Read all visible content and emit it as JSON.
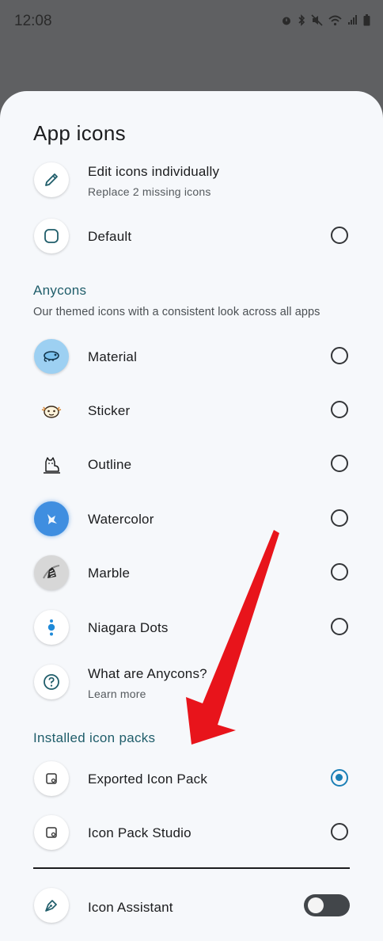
{
  "status_bar": {
    "time": "12:08",
    "icons": [
      "alarm-icon",
      "bluetooth-icon",
      "mute-icon",
      "wifi-icon",
      "signal-icon",
      "battery-icon"
    ]
  },
  "sheet": {
    "title": "App icons",
    "edit": {
      "label": "Edit icons individually",
      "sub": "Replace 2 missing icons",
      "icon": "pencil-icon"
    },
    "default": {
      "label": "Default",
      "icon": "rounded-square-icon",
      "selected": false
    },
    "anycons": {
      "header": "Anycons",
      "description": "Our themed icons with a consistent look across all apps",
      "items": [
        {
          "label": "Material",
          "icon": "chameleon-material-icon",
          "selected": false
        },
        {
          "label": "Sticker",
          "icon": "axolotl-sticker-icon",
          "selected": false
        },
        {
          "label": "Outline",
          "icon": "cat-outline-icon",
          "selected": false
        },
        {
          "label": "Watercolor",
          "icon": "watercolor-icon",
          "selected": false
        },
        {
          "label": "Marble",
          "icon": "marble-icon",
          "selected": false
        },
        {
          "label": "Niagara Dots",
          "icon": "dots-icon",
          "selected": false
        }
      ],
      "help": {
        "label": "What are Anycons?",
        "sub": "Learn more",
        "icon": "question-icon"
      }
    },
    "installed": {
      "header": "Installed icon packs",
      "items": [
        {
          "label": "Exported Icon Pack",
          "icon": "icon-pack-icon",
          "selected": true
        },
        {
          "label": "Icon Pack Studio",
          "icon": "icon-pack-icon",
          "selected": false
        }
      ]
    },
    "assistant": {
      "label": "Icon Assistant",
      "icon": "pen-nib-icon",
      "enabled": false
    }
  },
  "colors": {
    "accent": "#1b7fb6",
    "section_header": "#1f5d6a",
    "arrow": "#e8141b",
    "scrim": "#5f6062",
    "sheet_bg": "#f6f8fb"
  }
}
